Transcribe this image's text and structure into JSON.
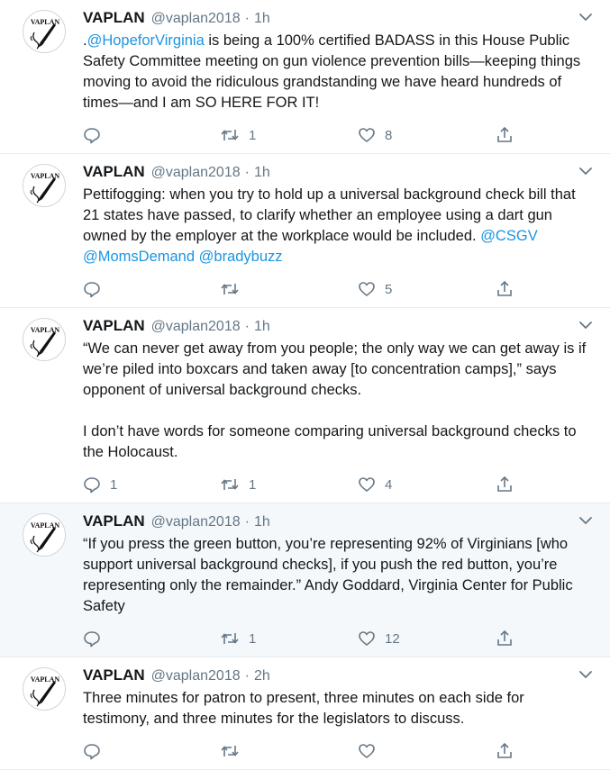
{
  "tweets": [
    {
      "name": "VAPLAN",
      "handle": "@vaplan2018",
      "time": "1h",
      "parts": [
        {
          "t": "."
        },
        {
          "t": "@HopeforVirginia",
          "m": true
        },
        {
          "t": " is being a 100% certified BADASS in this House Public Safety Committee meeting on gun violence prevention bills—keeping things moving to avoid the ridiculous grandstanding we have heard hundreds of times—and I am SO HERE FOR IT!"
        }
      ],
      "replies": "",
      "retweets": "1",
      "likes": "8",
      "threaded": false
    },
    {
      "name": "VAPLAN",
      "handle": "@vaplan2018",
      "time": "1h",
      "parts": [
        {
          "t": "Pettifogging: when you try to hold up a universal background check bill that 21 states have passed, to clarify whether an employee using a dart gun owned by the employer at the workplace would be included. "
        },
        {
          "t": "@CSGV",
          "m": true
        },
        {
          "t": " "
        },
        {
          "t": "@MomsDemand",
          "m": true
        },
        {
          "t": " "
        },
        {
          "t": "@bradybuzz",
          "m": true
        }
      ],
      "replies": "",
      "retweets": "",
      "likes": "5",
      "threaded": false
    },
    {
      "name": "VAPLAN",
      "handle": "@vaplan2018",
      "time": "1h",
      "parts": [
        {
          "t": "“We can never get away from you people; the only way we can get away is if we’re piled into boxcars and taken away [to concentration camps],” says opponent of universal background checks.\n\nI don’t have words for someone comparing universal background checks to the Holocaust."
        }
      ],
      "replies": "1",
      "retweets": "1",
      "likes": "4",
      "threaded": false
    },
    {
      "name": "VAPLAN",
      "handle": "@vaplan2018",
      "time": "1h",
      "parts": [
        {
          "t": "“If you press the green button, you’re representing 92% of Virginians [who support universal background checks], if you push the red button, you’re representing only the remainder.” Andy Goddard, Virginia Center for Public Safety"
        }
      ],
      "replies": "",
      "retweets": "1",
      "likes": "12",
      "threaded": true
    },
    {
      "name": "VAPLAN",
      "handle": "@vaplan2018",
      "time": "2h",
      "parts": [
        {
          "t": "Three minutes for patron to present, three minutes on each side for testimony, and three minutes for the legislators to discuss."
        }
      ],
      "replies": "",
      "retweets": "",
      "likes": "",
      "threaded": false
    }
  ],
  "avatar_text": "VAPLAN",
  "separator": "·",
  "colors": {
    "mention": "#1b95e0",
    "muted": "#657786",
    "border": "#e6ecf0",
    "threaded_bg": "#f5f8fa"
  },
  "icons": {
    "reply": "reply-icon",
    "retweet": "retweet-icon",
    "like": "heart-icon",
    "share": "share-icon",
    "caret": "chevron-down-icon"
  }
}
